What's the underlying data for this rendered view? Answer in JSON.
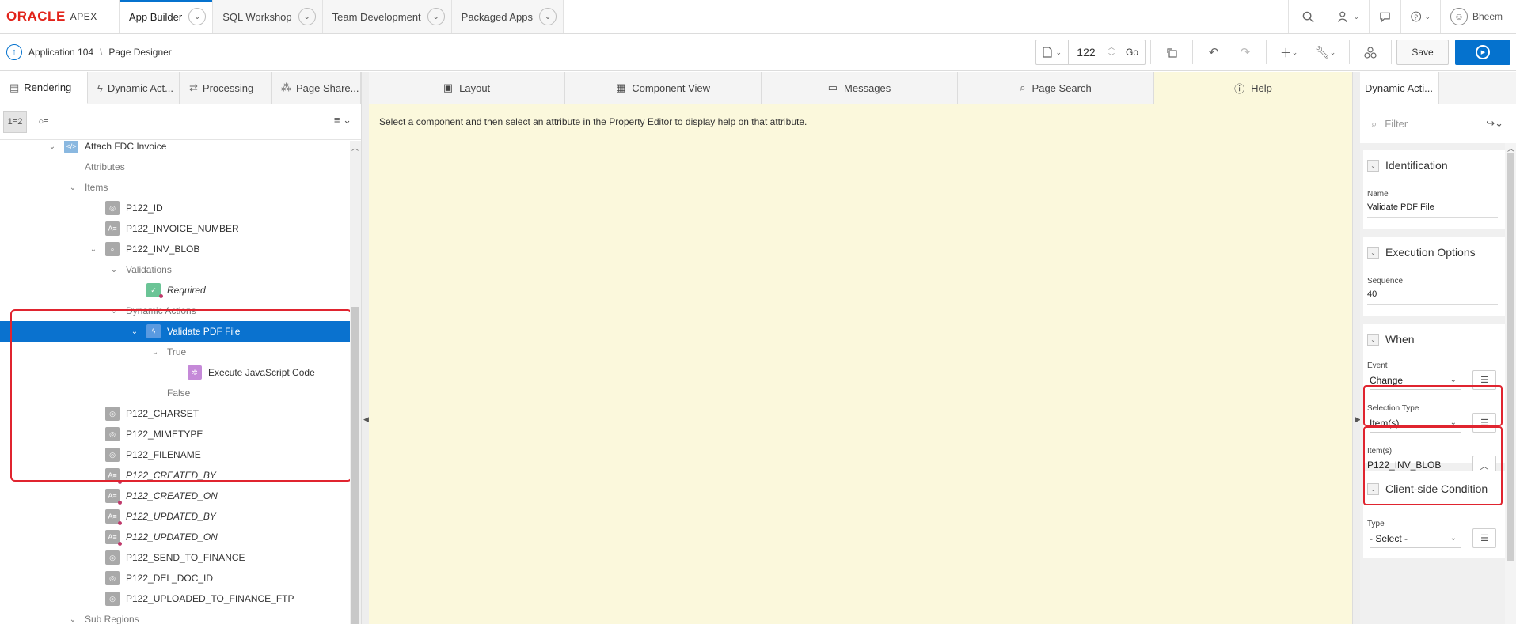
{
  "topnav": {
    "logo_oracle": "ORACLE",
    "logo_apex": "APEX",
    "tabs": [
      "App Builder",
      "SQL Workshop",
      "Team Development",
      "Packaged Apps"
    ],
    "user": "Bheem"
  },
  "toolbar": {
    "application": "Application 104",
    "separator": "\\",
    "page_designer": "Page Designer",
    "page_number": "122",
    "go_label": "Go",
    "save_label": "Save"
  },
  "left": {
    "tabs": [
      "Rendering",
      "Dynamic Act...",
      "Processing",
      "Page Share..."
    ],
    "view_tree": "1≡2",
    "view_group": "○≡",
    "tree": {
      "region": "Attach FDC Invoice",
      "attributes": "Attributes",
      "items": "Items",
      "p_id": "P122_ID",
      "p_invoice_number": "P122_INVOICE_NUMBER",
      "p_inv_blob": "P122_INV_BLOB",
      "validations": "Validations",
      "required": "Required",
      "dynamic_actions": "Dynamic Actions",
      "validate_pdf": "Validate PDF File",
      "true_label": "True",
      "execute_js": "Execute JavaScript Code",
      "false_label": "False",
      "p_charset": "P122_CHARSET",
      "p_mimetype": "P122_MIMETYPE",
      "p_filename": "P122_FILENAME",
      "p_created_by": "P122_CREATED_BY",
      "p_created_on": "P122_CREATED_ON",
      "p_updated_by": "P122_UPDATED_BY",
      "p_updated_on": "P122_UPDATED_ON",
      "p_send_to_finance": "P122_SEND_TO_FINANCE",
      "p_del_doc_id": "P122_DEL_DOC_ID",
      "p_uploaded_ftp": "P122_UPLOADED_TO_FINANCE_FTP",
      "sub_regions": "Sub Regions"
    }
  },
  "center": {
    "tabs": [
      "Layout",
      "Component View",
      "Messages",
      "Page Search",
      "Help"
    ],
    "help_text": "Select a component and then select an attribute in the Property Editor to display help on that attribute."
  },
  "right": {
    "tab": "Dynamic Acti...",
    "filter_placeholder": "Filter",
    "identification": "Identification",
    "name_label": "Name",
    "name_value": "Validate PDF File",
    "execution_options": "Execution Options",
    "sequence_label": "Sequence",
    "sequence_value": "40",
    "when": "When",
    "event_label": "Event",
    "event_value": "Change",
    "selection_type_label": "Selection Type",
    "selection_type_value": "Item(s)",
    "items_label": "Item(s)",
    "items_value": "P122_INV_BLOB",
    "client_side_condition": "Client-side Condition",
    "type_label": "Type",
    "type_value": "- Select -"
  },
  "colors": {
    "accent": "#0572ce",
    "selection": "#0a72cf",
    "help_background": "#fbf8dc",
    "highlight": "#e0242f",
    "oracle_red": "#e2231a"
  }
}
